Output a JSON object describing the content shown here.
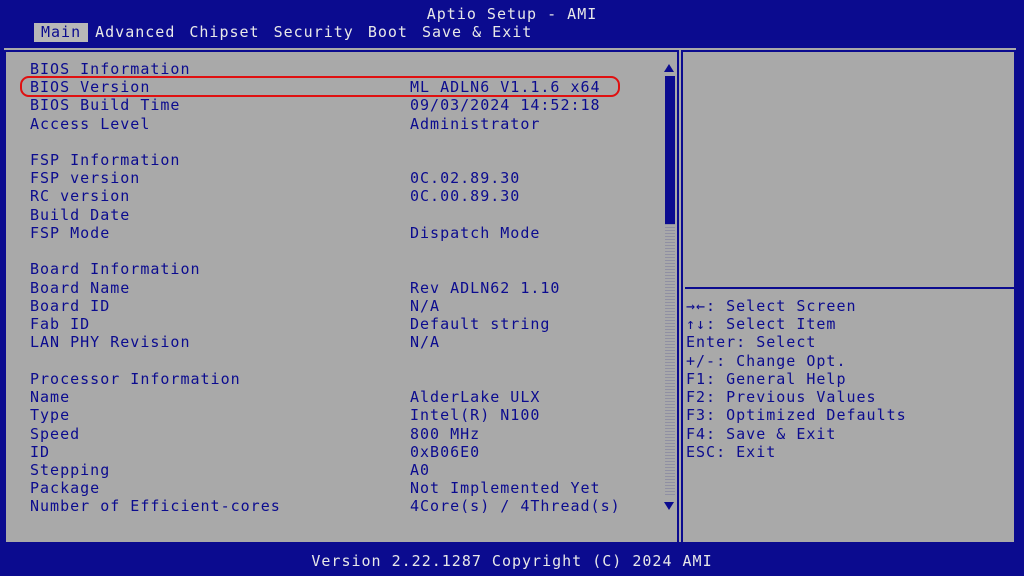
{
  "window": {
    "title": "Aptio Setup - AMI"
  },
  "tabs": [
    {
      "label": "Main",
      "active": true
    },
    {
      "label": "Advanced"
    },
    {
      "label": "Chipset"
    },
    {
      "label": "Security"
    },
    {
      "label": "Boot"
    },
    {
      "label": "Save & Exit"
    }
  ],
  "sections": {
    "bios": {
      "heading": "BIOS Information",
      "rows": [
        {
          "label": "BIOS Version",
          "value": "ML_ADLN6 V1.1.6 x64"
        },
        {
          "label": "BIOS Build Time",
          "value": "09/03/2024 14:52:18"
        },
        {
          "label": "Access Level",
          "value": "Administrator"
        }
      ]
    },
    "fsp": {
      "heading": "FSP Information",
      "rows": [
        {
          "label": "FSP version",
          "value": "0C.02.89.30"
        },
        {
          "label": "RC version",
          "value": "0C.00.89.30"
        },
        {
          "label": "Build Date",
          "value": ""
        },
        {
          "label": "FSP Mode",
          "value": "Dispatch Mode"
        }
      ]
    },
    "board": {
      "heading": "Board Information",
      "rows": [
        {
          "label": "Board Name",
          "value": "Rev ADLN62 1.10"
        },
        {
          "label": "Board ID",
          "value": "N/A"
        },
        {
          "label": "Fab ID",
          "value": "Default string"
        },
        {
          "label": "LAN PHY Revision",
          "value": "N/A"
        }
      ]
    },
    "processor": {
      "heading": "Processor Information",
      "rows": [
        {
          "label": "Name",
          "value": "AlderLake ULX"
        },
        {
          "label": "Type",
          "value": "Intel(R) N100"
        },
        {
          "label": "Speed",
          "value": "800 MHz"
        },
        {
          "label": "ID",
          "value": "0xB06E0"
        },
        {
          "label": "Stepping",
          "value": "A0"
        },
        {
          "label": "Package",
          "value": "Not Implemented Yet"
        },
        {
          "label": "Number of Efficient-cores",
          "value": "4Core(s) / 4Thread(s)"
        }
      ]
    }
  },
  "help": [
    "→←: Select Screen",
    "↑↓: Select Item",
    "Enter: Select",
    "+/-: Change Opt.",
    "F1: General Help",
    "F2: Previous Values",
    "F3: Optimized Defaults",
    "F4: Save & Exit",
    "ESC: Exit"
  ],
  "footer": {
    "text": "Version 2.22.1287 Copyright (C) 2024 AMI"
  },
  "colors": {
    "bios_blue": "#0b0b8f",
    "panel_gray": "#a9a9a9",
    "text_white": "#e8e8e8",
    "highlight_red": "#e01010"
  }
}
